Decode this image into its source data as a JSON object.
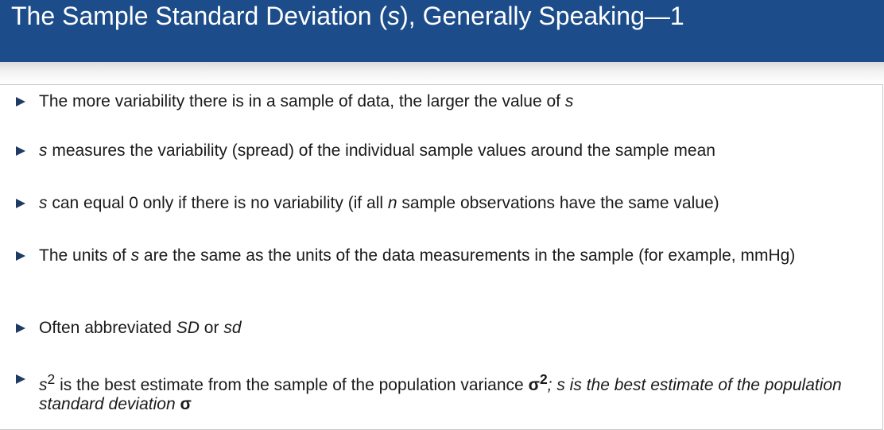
{
  "slide": {
    "title": {
      "pre": "The Sample Standard Deviation (",
      "var": "s",
      "post": "), Generally Speaking—1"
    },
    "bullets": [
      {
        "id": "more-variability",
        "text": "The more variability there is in a sample of data, the larger the value of ",
        "var": "s"
      },
      {
        "id": "measures-spread",
        "var": "s",
        "text": " measures the variability (spread) of the individual sample values around the sample mean"
      },
      {
        "id": "zero-only",
        "var": "s",
        "text_a": " can equal 0 only if there is no variability (if all ",
        "var_n": "n",
        "text_b": " sample observations have the same value)"
      },
      {
        "id": "units",
        "text_a": "The units of ",
        "var": "s",
        "text_b": " are the same as the units of the data measurements in the sample (for example, mmHg)"
      },
      {
        "id": "abbreviation",
        "text": "Often abbreviated ",
        "abbr1": "SD",
        "or": " or ",
        "abbr2": "sd"
      },
      {
        "id": "best-estimate",
        "var": "s",
        "sup": "2",
        "text_a": " is the best estimate from the sample of the population variance ",
        "sigma": "σ",
        "sigma_sup": "2",
        "text_b": "; s is the best estimate of the population standard deviation ",
        "sigma2": "σ"
      }
    ]
  },
  "colors": {
    "title_bg": "#1c4d8a",
    "title_text": "#ffffff",
    "marker": "#1f3b63",
    "body_text": "#1a1a1a"
  },
  "icons": {
    "bullet_marker": "triangle-right-icon"
  }
}
